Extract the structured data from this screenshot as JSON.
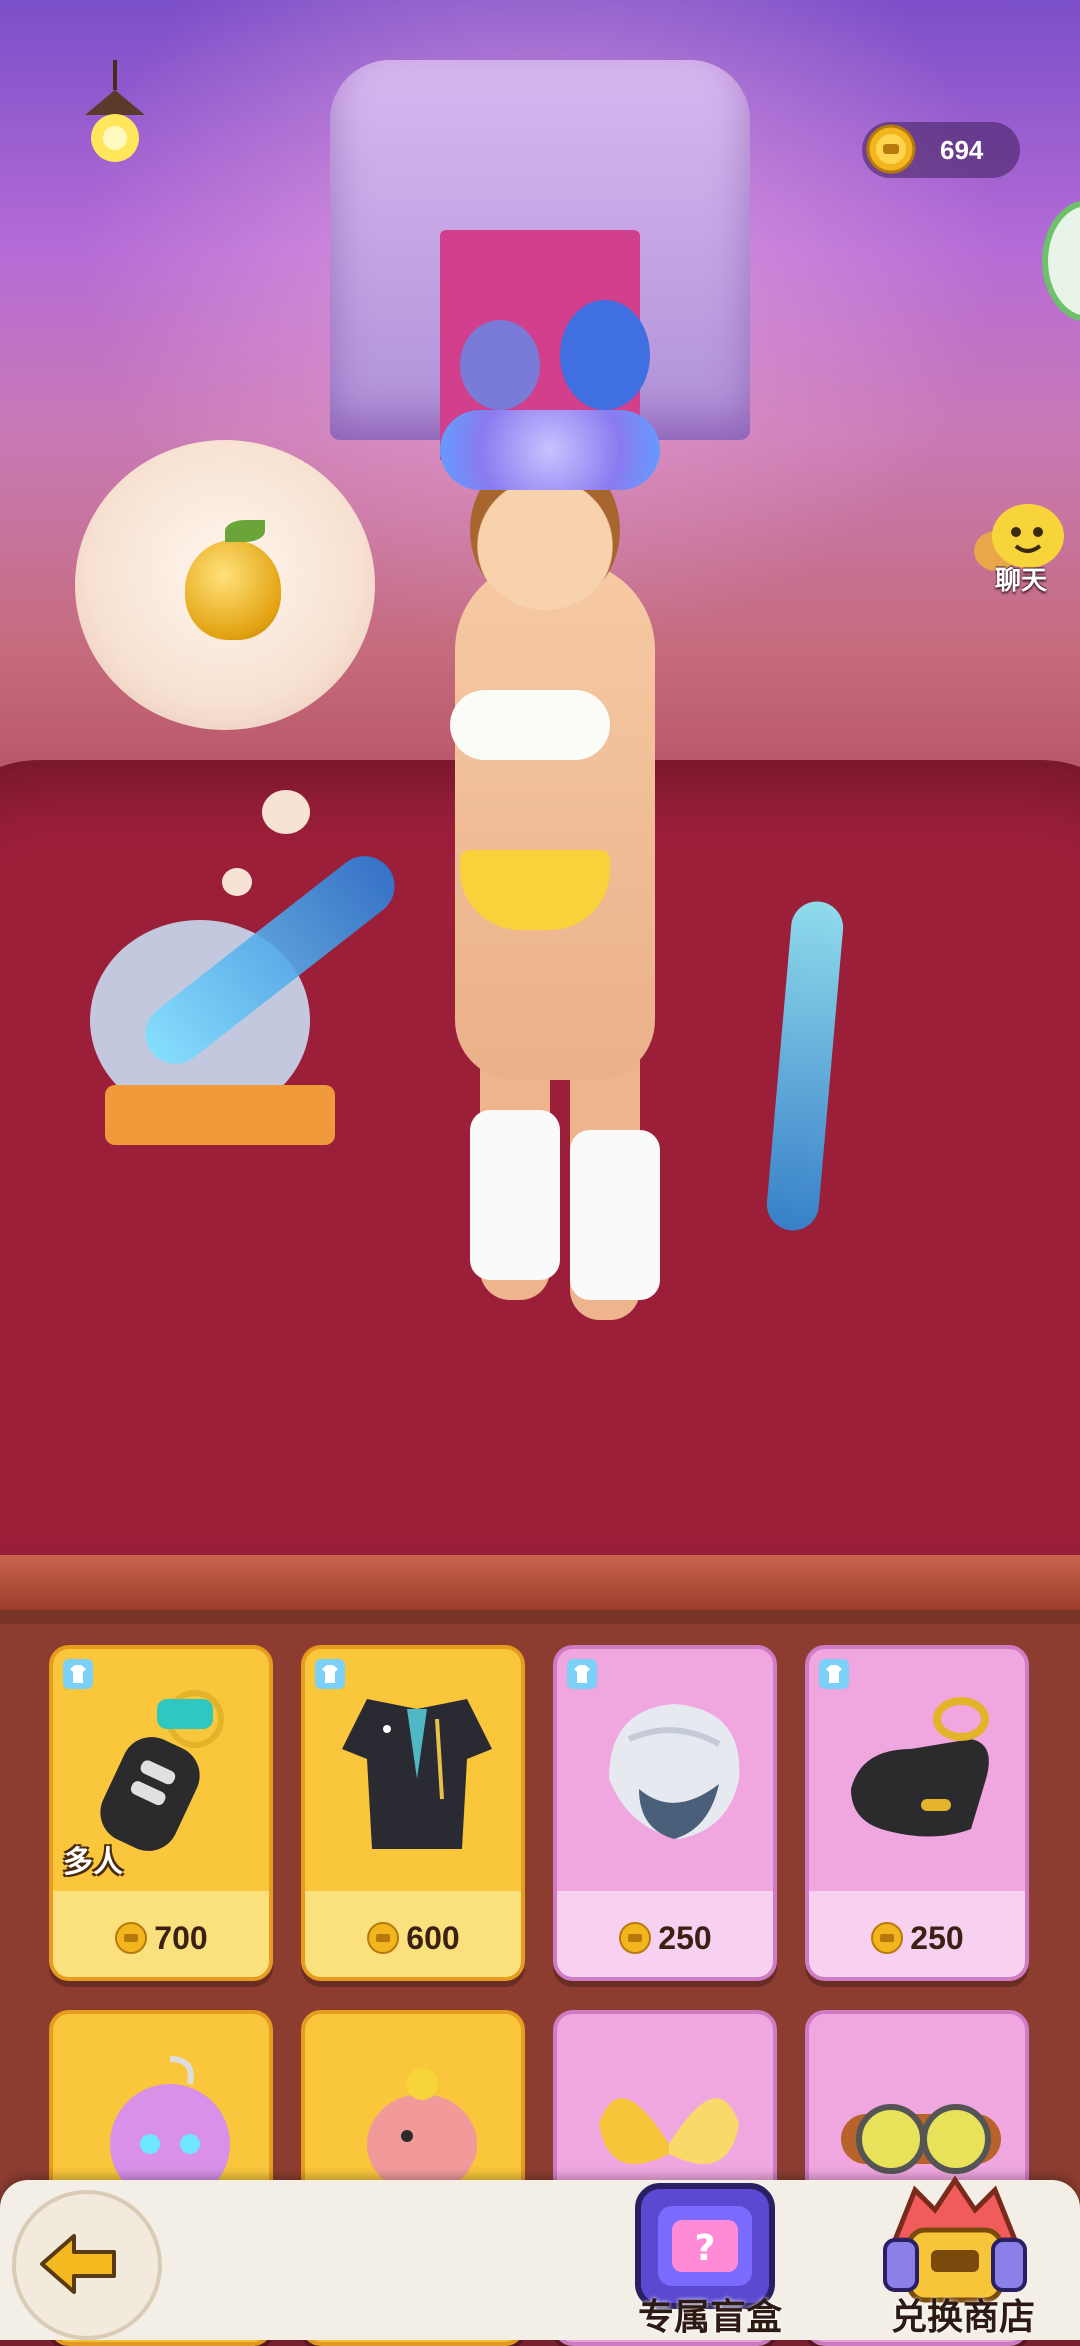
{
  "hud": {
    "coins": "694",
    "chat_label": "聊天"
  },
  "shop": {
    "items": [
      {
        "price": "700",
        "rarity": "gold",
        "badge": "多人",
        "icon": "car-key-icon"
      },
      {
        "price": "600",
        "rarity": "gold",
        "badge": "",
        "icon": "tuxedo-suit-icon"
      },
      {
        "price": "250",
        "rarity": "pink",
        "badge": "",
        "icon": "silver-hair-icon"
      },
      {
        "price": "250",
        "rarity": "pink",
        "badge": "",
        "icon": "black-glove-icon"
      },
      {
        "price": "",
        "rarity": "gold",
        "badge": "",
        "icon": "pink-pet-icon"
      },
      {
        "price": "",
        "rarity": "gold",
        "badge": "",
        "icon": "dino-pet-icon"
      },
      {
        "price": "",
        "rarity": "pink",
        "badge": "",
        "icon": "butterfly-icon"
      },
      {
        "price": "",
        "rarity": "pink",
        "badge": "",
        "icon": "goggles-icon"
      }
    ]
  },
  "bottom_bar": {
    "blind_box_label": "专属盲盒",
    "exchange_shop_label": "兑换商店"
  },
  "colors": {
    "gold_card": "#f9c63c",
    "pink_card": "#f0a7e0",
    "shop_bg": "#8c3d30"
  }
}
